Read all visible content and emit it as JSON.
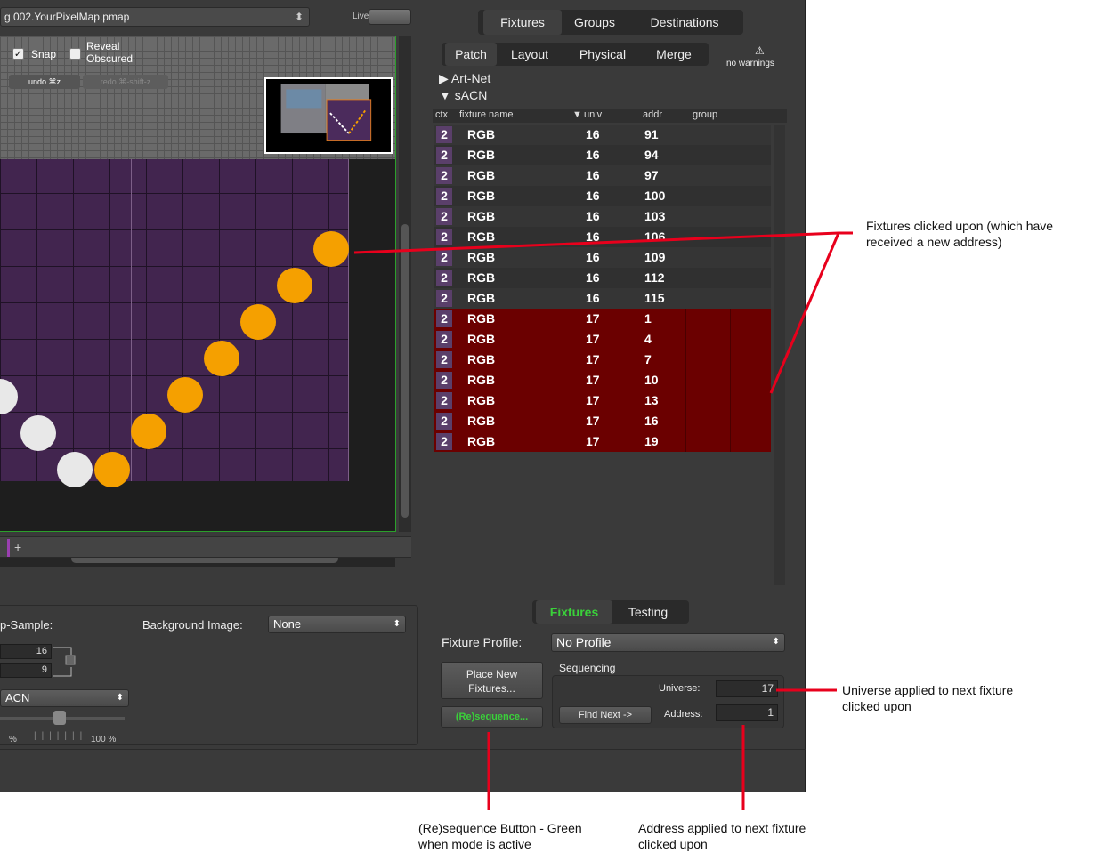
{
  "window": {
    "file_title": "g 002.YourPixelMap.pmap",
    "live_label": "Live"
  },
  "canvas": {
    "snap_label": "Snap",
    "snap_checked": true,
    "reveal_label": "Reveal Obscured",
    "undo_label": "undo ⌘z",
    "redo_label": "redo ⌘-shift-z"
  },
  "left_panel": {
    "upsample_label": "p-Sample:",
    "bg_image_label": "Background Image:",
    "bg_image_value": "None",
    "width_value": "16",
    "height_value": "9",
    "protocol_value": "ACN",
    "zoom_min_label": "%",
    "zoom_max_label": "100 %"
  },
  "right_panel": {
    "top_tabs": [
      "Fixtures",
      "Groups",
      "Destinations"
    ],
    "sub_tabs": [
      "Patch",
      "Layout",
      "Physical",
      "Merge"
    ],
    "warning_label": "no warnings",
    "tree_artnet": "Art-Net",
    "tree_sacn": "sACN",
    "columns": {
      "ctx": "ctx",
      "fixture_name": "fixture name",
      "univ": "univ",
      "addr": "addr",
      "group": "group"
    },
    "rows": [
      {
        "ctx": "2",
        "name": "RGB",
        "univ": "16",
        "addr": "91",
        "hl": false
      },
      {
        "ctx": "2",
        "name": "RGB",
        "univ": "16",
        "addr": "94",
        "hl": false
      },
      {
        "ctx": "2",
        "name": "RGB",
        "univ": "16",
        "addr": "97",
        "hl": false
      },
      {
        "ctx": "2",
        "name": "RGB",
        "univ": "16",
        "addr": "100",
        "hl": false
      },
      {
        "ctx": "2",
        "name": "RGB",
        "univ": "16",
        "addr": "103",
        "hl": false
      },
      {
        "ctx": "2",
        "name": "RGB",
        "univ": "16",
        "addr": "106",
        "hl": false
      },
      {
        "ctx": "2",
        "name": "RGB",
        "univ": "16",
        "addr": "109",
        "hl": false
      },
      {
        "ctx": "2",
        "name": "RGB",
        "univ": "16",
        "addr": "112",
        "hl": false
      },
      {
        "ctx": "2",
        "name": "RGB",
        "univ": "16",
        "addr": "115",
        "hl": false
      },
      {
        "ctx": "2",
        "name": "RGB",
        "univ": "17",
        "addr": "1",
        "hl": true
      },
      {
        "ctx": "2",
        "name": "RGB",
        "univ": "17",
        "addr": "4",
        "hl": true
      },
      {
        "ctx": "2",
        "name": "RGB",
        "univ": "17",
        "addr": "7",
        "hl": true
      },
      {
        "ctx": "2",
        "name": "RGB",
        "univ": "17",
        "addr": "10",
        "hl": true
      },
      {
        "ctx": "2",
        "name": "RGB",
        "univ": "17",
        "addr": "13",
        "hl": true
      },
      {
        "ctx": "2",
        "name": "RGB",
        "univ": "17",
        "addr": "16",
        "hl": true
      },
      {
        "ctx": "2",
        "name": "RGB",
        "univ": "17",
        "addr": "19",
        "hl": true
      }
    ],
    "bottom_tabs": [
      "Fixtures",
      "Testing"
    ],
    "fixture_profile_label": "Fixture Profile:",
    "fixture_profile_value": "No Profile",
    "place_new_label": "Place New Fixtures...",
    "resequence_label": "(Re)sequence...",
    "sequencing_label": "Sequencing",
    "universe_label": "Universe:",
    "universe_value": "17",
    "find_next_label": "Find Next ->",
    "address_label": "Address:",
    "address_value": "1"
  },
  "annotations": {
    "fixtures_clicked": "Fixtures clicked upon (which have received a new address)",
    "universe_applied": "Universe applied to next fixture clicked upon",
    "resequence_button": "(Re)sequence Button - Green when mode is active",
    "address_applied": "Address applied to next fixture clicked upon"
  },
  "colors": {
    "highlight_row": "#6b0000",
    "active_green": "#3ad13a",
    "fixture_orange": "#f5a000",
    "annotation_red": "#e8001c"
  }
}
